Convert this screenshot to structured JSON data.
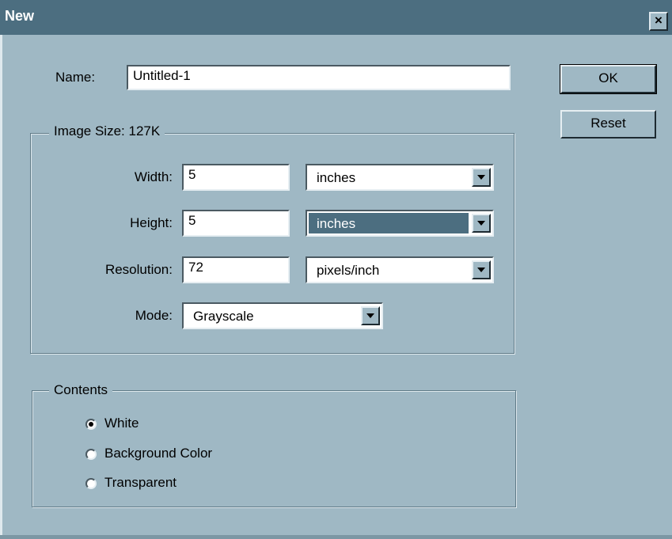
{
  "window": {
    "title": "New",
    "close_glyph": "×"
  },
  "name": {
    "label": "Name:",
    "value": "Untitled-1"
  },
  "buttons": {
    "ok": "OK",
    "reset": "Reset"
  },
  "image_size": {
    "legend": "Image Size: 127K",
    "width": {
      "label": "Width:",
      "value": "5",
      "unit": "inches"
    },
    "height": {
      "label": "Height:",
      "value": "5",
      "unit": "inches"
    },
    "resolution": {
      "label": "Resolution:",
      "value": "72",
      "unit": "pixels/inch"
    },
    "mode": {
      "label": "Mode:",
      "value": "Grayscale"
    }
  },
  "contents": {
    "legend": "Contents",
    "options": [
      {
        "label": "White",
        "selected": true
      },
      {
        "label": "Background Color",
        "selected": false
      },
      {
        "label": "Transparent",
        "selected": false
      }
    ]
  },
  "colors": {
    "titlebar": "#4c6e80",
    "dialog_bg": "#9fb8c4",
    "selection": "#4c6e80"
  },
  "icons": {
    "close": "close-icon",
    "dropdown": "chevron-down-icon",
    "radio": "radio-icon"
  }
}
